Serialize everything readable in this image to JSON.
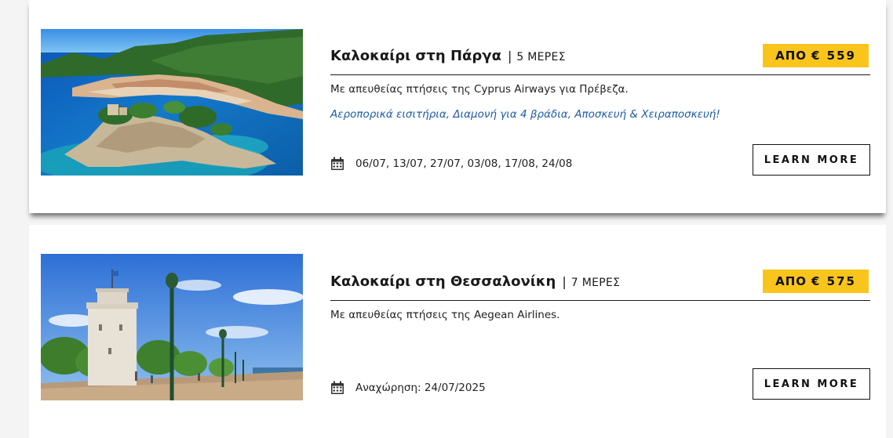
{
  "tours": [
    {
      "title": "Καλοκαίρι στη Πάργα",
      "separator": "|",
      "duration": "5 ΜΕΡΕΣ",
      "price_prefix": "ΑΠΟ",
      "price": "€ 559",
      "description": "Με απευθείας πτήσεις της Cyprus Airways για Πρέβεζα.",
      "includes": "Αεροπορικά εισιτήρια, Διαμονή για 4 βράδια, Αποσκευή & Χειραποσκευή!",
      "calendar_icon": "calendar-icon",
      "dates": "06/07, 13/07, 27/07, 03/08, 17/08, 24/08",
      "button_label": "LEARN MORE"
    },
    {
      "title": "Καλοκαίρι στη Θεσσαλονίκη",
      "separator": "|",
      "duration": "7 ΜΕΡΕΣ",
      "price_prefix": "ΑΠΟ",
      "price": "€ 575",
      "description": "Με απευθείας πτήσεις της Aegean Airlines.",
      "calendar_icon": "calendar-icon",
      "dates": "Αναχώρηση: 24/07/2025",
      "button_label": "LEARN MORE"
    }
  ],
  "colors": {
    "price_badge": "#f9c51c",
    "includes_text": "#1d5aa6",
    "page_background": "#f4f4f4",
    "card_background": "#ffffff"
  }
}
